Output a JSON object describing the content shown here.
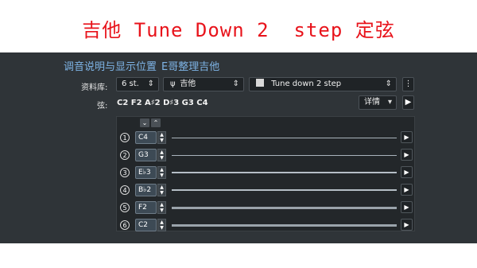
{
  "banner": {
    "title": "吉他 Tune Down 2  step 定弦"
  },
  "panel": {
    "heading": "调音说明与显示位置",
    "heading_sub": "E哥整理吉他",
    "library_label": "资料库:",
    "library_value": "6 st.",
    "instrument_value": "吉他",
    "tuning_value": "Tune down 2 step",
    "strings_label": "弦:",
    "strings_notes": "C2 F2 A♯2 D♯3 G3 C4",
    "detail_label": "详情"
  },
  "strings": [
    {
      "num": "1",
      "note": "C4",
      "color": "#a9b3bc",
      "width": 1
    },
    {
      "num": "2",
      "note": "G3",
      "color": "#a9b3bc",
      "width": 1
    },
    {
      "num": "3",
      "note": "E♭3",
      "color": "#b5bec6",
      "width": 2
    },
    {
      "num": "4",
      "note": "B♭2",
      "color": "#b5bec6",
      "width": 2
    },
    {
      "num": "5",
      "note": "F2",
      "color": "#9aa3ab",
      "width": 3
    },
    {
      "num": "6",
      "note": "C2",
      "color": "#9aa3ab",
      "width": 3
    }
  ],
  "colors": {
    "accent": "#e8131b",
    "heading": "#7eb4e6",
    "panel_bg": "#2f3438"
  }
}
